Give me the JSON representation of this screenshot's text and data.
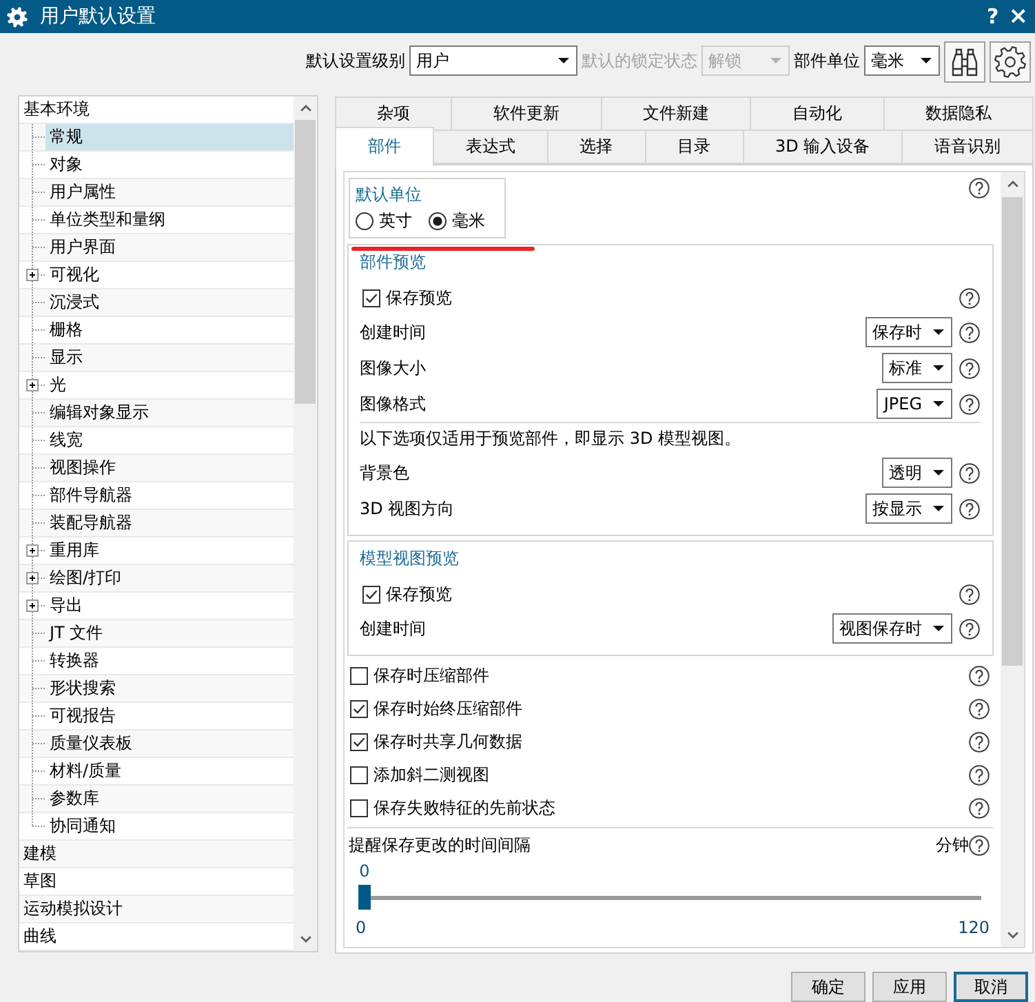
{
  "window": {
    "title": "用户默认设置",
    "controls": [
      {
        "kind": "help",
        "glyph": "?"
      },
      {
        "kind": "close",
        "glyph": "×"
      }
    ]
  },
  "toolbar": {
    "fields": [
      {
        "label": "默认设置级别",
        "value": "用户",
        "disabled": false
      },
      {
        "label": "默认的锁定状态",
        "value": "解锁",
        "disabled": true
      },
      {
        "label": "部件单位",
        "value": "毫米",
        "disabled": false
      }
    ]
  },
  "sidebar": {
    "items": [
      {
        "label": "基本环境",
        "selected": false,
        "children": [
          {
            "label": "常规",
            "selected": true,
            "expandable": false
          },
          {
            "label": "对象",
            "selected": false,
            "expandable": false
          },
          {
            "label": "用户属性",
            "selected": false,
            "expandable": false
          },
          {
            "label": "单位类型和量纲",
            "selected": false,
            "expandable": false
          },
          {
            "label": "用户界面",
            "selected": false,
            "expandable": false
          },
          {
            "label": "可视化",
            "selected": false,
            "expandable": true
          },
          {
            "label": "沉浸式",
            "selected": false,
            "expandable": false
          },
          {
            "label": "栅格",
            "selected": false,
            "expandable": false
          },
          {
            "label": "显示",
            "selected": false,
            "expandable": false
          },
          {
            "label": "光",
            "selected": false,
            "expandable": true
          },
          {
            "label": "编辑对象显示",
            "selected": false,
            "expandable": false
          },
          {
            "label": "线宽",
            "selected": false,
            "expandable": false
          },
          {
            "label": "视图操作",
            "selected": false,
            "expandable": false
          },
          {
            "label": "部件导航器",
            "selected": false,
            "expandable": false
          },
          {
            "label": "装配导航器",
            "selected": false,
            "expandable": false
          },
          {
            "label": "重用库",
            "selected": false,
            "expandable": true
          },
          {
            "label": "绘图/打印",
            "selected": false,
            "expandable": true
          },
          {
            "label": "导出",
            "selected": false,
            "expandable": true
          },
          {
            "label": "JT 文件",
            "selected": false,
            "expandable": false
          },
          {
            "label": "转换器",
            "selected": false,
            "expandable": false
          },
          {
            "label": "形状搜索",
            "selected": false,
            "expandable": false
          },
          {
            "label": "可视报告",
            "selected": false,
            "expandable": false
          },
          {
            "label": "质量仪表板",
            "selected": false,
            "expandable": false
          },
          {
            "label": "材料/质量",
            "selected": false,
            "expandable": false
          },
          {
            "label": "参数库",
            "selected": false,
            "expandable": false
          },
          {
            "label": "协同通知",
            "selected": false,
            "expandable": false
          }
        ]
      },
      {
        "label": "建模",
        "selected": false
      },
      {
        "label": "草图",
        "selected": false
      },
      {
        "label": "运动模拟设计",
        "selected": false
      },
      {
        "label": "曲线",
        "selected": false
      }
    ]
  },
  "tab_rows": [
    {
      "tabs": [
        {
          "label": "杂项",
          "selected": false
        },
        {
          "label": "软件更新",
          "selected": false
        },
        {
          "label": "文件新建",
          "selected": false
        },
        {
          "label": "自动化",
          "selected": false
        },
        {
          "label": "数据隐私",
          "selected": false
        }
      ]
    },
    {
      "tabs": [
        {
          "label": "部件",
          "selected": true
        },
        {
          "label": "表达式",
          "selected": false
        },
        {
          "label": "选择",
          "selected": false
        },
        {
          "label": "目录",
          "selected": false
        },
        {
          "label": "3D 输入设备",
          "selected": false
        },
        {
          "label": "语音识别",
          "selected": false
        }
      ]
    }
  ],
  "page": {
    "units": {
      "title": "默认单位",
      "options": [
        {
          "label": "英寸",
          "selected": false
        },
        {
          "label": "毫米",
          "selected": true
        }
      ]
    },
    "groups": [
      {
        "title": "部件预览",
        "rows": [
          {
            "kind": "checkbox",
            "label": "保存预览",
            "checked": true
          },
          {
            "kind": "dropdown",
            "label": "创建时间",
            "value": "保存时"
          },
          {
            "kind": "dropdown",
            "label": "图像大小",
            "value": "标准"
          },
          {
            "kind": "dropdown",
            "label": "图像格式",
            "value": "JPEG"
          },
          {
            "kind": "note",
            "text": "以下选项仅适用于预览部件，即显示 3D 模型视图。"
          },
          {
            "kind": "dropdown",
            "label": "背景色",
            "value": "透明"
          },
          {
            "kind": "dropdown",
            "label": "3D 视图方向",
            "value": "按显示"
          }
        ]
      },
      {
        "title": "模型视图预览",
        "rows": [
          {
            "kind": "checkbox",
            "label": "保存预览",
            "checked": true
          },
          {
            "kind": "dropdown",
            "label": "创建时间",
            "value": "视图保存时"
          }
        ]
      }
    ],
    "options": [
      {
        "label": "保存时压缩部件",
        "checked": false
      },
      {
        "label": "保存时始终压缩部件",
        "checked": true
      },
      {
        "label": "保存时共享几何数据",
        "checked": true
      },
      {
        "label": "添加斜二测视图",
        "checked": false
      },
      {
        "label": "保存失败特征的先前状态",
        "checked": false
      }
    ],
    "reminder": {
      "label": "提醒保存更改的时间间隔",
      "unit": "分钟",
      "value": "0",
      "min": "0",
      "max": "120",
      "level": 0
    }
  },
  "buttons": [
    {
      "label": "确定",
      "focused": false
    },
    {
      "label": "应用",
      "focused": false
    },
    {
      "label": "取消",
      "focused": true
    }
  ]
}
